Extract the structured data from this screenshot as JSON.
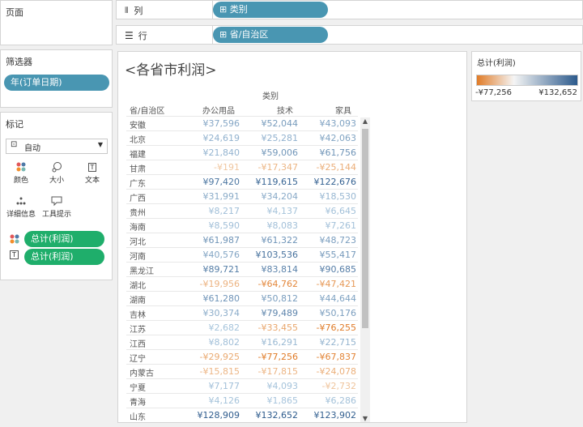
{
  "pages": {
    "title": "页面"
  },
  "columns_shelf": {
    "label": "列",
    "pill": "类别"
  },
  "rows_shelf": {
    "label": "行",
    "pill": "省/自治区"
  },
  "filters": {
    "title": "筛选器",
    "pill": "年(订单日期)"
  },
  "marks": {
    "title": "标记",
    "type_select": "自动",
    "buttons": [
      {
        "label": "颜色",
        "icon": "color-icon"
      },
      {
        "label": "大小",
        "icon": "size-icon"
      },
      {
        "label": "文本",
        "icon": "text-icon"
      },
      {
        "label": "详细信息",
        "icon": "detail-icon"
      },
      {
        "label": "工具提示",
        "icon": "tooltip-icon"
      }
    ],
    "pills": [
      "总计(利润)",
      "总计(利润)"
    ]
  },
  "legend": {
    "title": "总计(利润)",
    "min": "-¥77,256",
    "max": "¥132,652",
    "colors": {
      "neg": "#e07b27",
      "mid": "#f5f5f5",
      "pos": "#2c5a8c"
    }
  },
  "sheet": {
    "title": "<各省市利润>",
    "column_group": "类别",
    "row_header": "省/自治区",
    "categories": [
      "办公用品",
      "技术",
      "家具"
    ]
  },
  "chart_data": {
    "type": "table",
    "column_group": "类别",
    "categories": [
      "办公用品",
      "技术",
      "家具"
    ],
    "rows": [
      {
        "province": "安徽",
        "values": [
          37596,
          52044,
          43093
        ],
        "labels": [
          "¥37,596",
          "¥52,044",
          "¥43,093"
        ]
      },
      {
        "province": "北京",
        "values": [
          24619,
          25281,
          42063
        ],
        "labels": [
          "¥24,619",
          "¥25,281",
          "¥42,063"
        ]
      },
      {
        "province": "福建",
        "values": [
          21840,
          59006,
          61756
        ],
        "labels": [
          "¥21,840",
          "¥59,006",
          "¥61,756"
        ]
      },
      {
        "province": "甘肃",
        "values": [
          -191,
          -17347,
          -25144
        ],
        "labels": [
          "-¥191",
          "-¥17,347",
          "-¥25,144"
        ]
      },
      {
        "province": "广东",
        "values": [
          97420,
          119615,
          122676
        ],
        "labels": [
          "¥97,420",
          "¥119,615",
          "¥122,676"
        ]
      },
      {
        "province": "广西",
        "values": [
          31991,
          34204,
          18530
        ],
        "labels": [
          "¥31,991",
          "¥34,204",
          "¥18,530"
        ]
      },
      {
        "province": "贵州",
        "values": [
          8217,
          4137,
          6645
        ],
        "labels": [
          "¥8,217",
          "¥4,137",
          "¥6,645"
        ]
      },
      {
        "province": "海南",
        "values": [
          8590,
          8083,
          7261
        ],
        "labels": [
          "¥8,590",
          "¥8,083",
          "¥7,261"
        ]
      },
      {
        "province": "河北",
        "values": [
          61987,
          61322,
          48723
        ],
        "labels": [
          "¥61,987",
          "¥61,322",
          "¥48,723"
        ]
      },
      {
        "province": "河南",
        "values": [
          40576,
          103536,
          55417
        ],
        "labels": [
          "¥40,576",
          "¥103,536",
          "¥55,417"
        ]
      },
      {
        "province": "黑龙江",
        "values": [
          89721,
          83814,
          90685
        ],
        "labels": [
          "¥89,721",
          "¥83,814",
          "¥90,685"
        ]
      },
      {
        "province": "湖北",
        "values": [
          -19956,
          -64762,
          -47421
        ],
        "labels": [
          "-¥19,956",
          "-¥64,762",
          "-¥47,421"
        ]
      },
      {
        "province": "湖南",
        "values": [
          61280,
          50812,
          44644
        ],
        "labels": [
          "¥61,280",
          "¥50,812",
          "¥44,644"
        ]
      },
      {
        "province": "吉林",
        "values": [
          30374,
          79489,
          50176
        ],
        "labels": [
          "¥30,374",
          "¥79,489",
          "¥50,176"
        ]
      },
      {
        "province": "江苏",
        "values": [
          2682,
          -33455,
          -76255
        ],
        "labels": [
          "¥2,682",
          "-¥33,455",
          "-¥76,255"
        ]
      },
      {
        "province": "江西",
        "values": [
          8802,
          16291,
          22715
        ],
        "labels": [
          "¥8,802",
          "¥16,291",
          "¥22,715"
        ]
      },
      {
        "province": "辽宁",
        "values": [
          -29925,
          -77256,
          -67837
        ],
        "labels": [
          "-¥29,925",
          "-¥77,256",
          "-¥67,837"
        ]
      },
      {
        "province": "内蒙古",
        "values": [
          -15815,
          -17815,
          -24078
        ],
        "labels": [
          "-¥15,815",
          "-¥17,815",
          "-¥24,078"
        ]
      },
      {
        "province": "宁夏",
        "values": [
          7177,
          4093,
          -2732
        ],
        "labels": [
          "¥7,177",
          "¥4,093",
          "-¥2,732"
        ]
      },
      {
        "province": "青海",
        "values": [
          4126,
          1865,
          6286
        ],
        "labels": [
          "¥4,126",
          "¥1,865",
          "¥6,286"
        ]
      },
      {
        "province": "山东",
        "values": [
          128909,
          132652,
          123902
        ],
        "labels": [
          "¥128,909",
          "¥132,652",
          "¥123,902"
        ]
      }
    ],
    "color_range": [
      -77256,
      132652
    ]
  }
}
